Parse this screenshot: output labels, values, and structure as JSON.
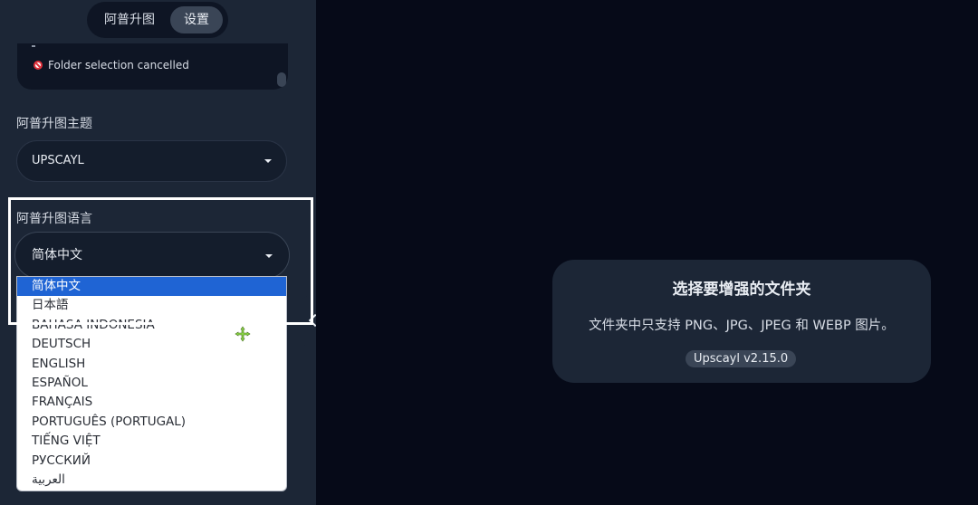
{
  "tabs": {
    "upscale_label": "阿普升图",
    "settings_label": "设置"
  },
  "log": {
    "message": "Folder selection cancelled"
  },
  "theme": {
    "label": "阿普升图主题",
    "value": "UPSCAYL"
  },
  "language": {
    "label": "阿普升图语言",
    "value": "简体中文",
    "options": [
      "简体中文",
      "日本語",
      "BAHASA INDONESIA",
      "DEUTSCH",
      "ENGLISH",
      "ESPAÑOL",
      "FRANÇAIS",
      "PORTUGUÊS (PORTUGAL)",
      "TIẾNG VIỆT",
      "РУССКИЙ",
      "العربية"
    ],
    "selected_index": 0
  },
  "main": {
    "title": "选择要增强的文件夹",
    "description": "文件夹中只支持 PNG、JPG、JPEG 和 WEBP 图片。",
    "version": "Upscayl v2.15.0"
  },
  "icons": {
    "log_status": "cancel-icon",
    "select_caret": "caret-down-icon",
    "collapse": "chevron-left-icon",
    "cursor": "move-icon"
  },
  "colors": {
    "accent_selected": "#1f64d4",
    "cursor_green": "#8fd94a",
    "error_red": "#e0323c"
  }
}
